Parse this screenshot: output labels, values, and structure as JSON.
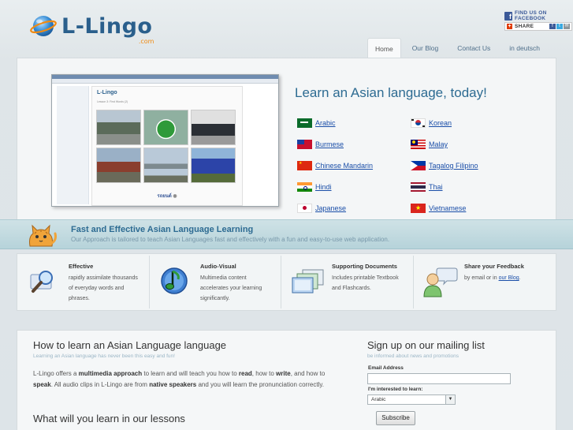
{
  "header": {
    "logo_text": "L-Lingo",
    "logo_sub": ".com",
    "facebook_label": "FIND US ON FACEBOOK",
    "share_label": "SHARE"
  },
  "nav": [
    {
      "label": "Home",
      "active": true
    },
    {
      "label": "Our Blog",
      "active": false
    },
    {
      "label": "Contact Us",
      "active": false
    },
    {
      "label": "in deutsch",
      "active": false
    }
  ],
  "hero": {
    "title": "Learn an Asian language, today!",
    "screenshot": {
      "logo": "L-Lingo",
      "heading": "Lesson 3: First Words (2)",
      "footer_word": "รถยนต์"
    },
    "languages": [
      {
        "name": "Arabic",
        "flag": "arabic-flag"
      },
      {
        "name": "Korean",
        "flag": "korean-flag"
      },
      {
        "name": "Burmese",
        "flag": "burmese-flag"
      },
      {
        "name": "Malay",
        "flag": "malay-flag"
      },
      {
        "name": "Chinese Mandarin",
        "flag": "chinese-flag"
      },
      {
        "name": "Tagalog Filipino",
        "flag": "filipino-flag"
      },
      {
        "name": "Hindi",
        "flag": "hindi-flag"
      },
      {
        "name": "Thai",
        "flag": "thai-flag"
      },
      {
        "name": "Japanese",
        "flag": "japanese-flag"
      },
      {
        "name": "Vietnamese",
        "flag": "vietnamese-flag"
      }
    ]
  },
  "banner": {
    "title": "Fast and Effective Asian Language Learning",
    "subtitle": "Our Approach is tailored to teach Asian Languages fast and effectively with a fun and easy-to-use web application."
  },
  "features": [
    {
      "title": "Effective",
      "text": "rapidly assimilate thousands of everyday words and phrases.",
      "icon": "magnifier-icon"
    },
    {
      "title": "Audio-Visual",
      "text": "Multimedia content accelerates your learning significantly.",
      "icon": "music-note-icon"
    },
    {
      "title": "Supporting Documents",
      "text": "Includes printable Textbook and Flashcards.",
      "icon": "documents-icon"
    },
    {
      "title": "Share your Feedback",
      "text_before": "by email or in ",
      "link": "our Blog",
      "text_after": ".",
      "icon": "feedback-person-icon"
    }
  ],
  "content": {
    "title": "How to learn an Asian Language language",
    "subtitle": "Learning an Asian language has never been this easy and fun!",
    "para": [
      {
        "t": "L-Lingo offers a "
      },
      {
        "t": "multimedia approach",
        "b": true
      },
      {
        "t": " to learn and will teach you how to "
      },
      {
        "t": "read",
        "b": true
      },
      {
        "t": ", how to "
      },
      {
        "t": "write",
        "b": true
      },
      {
        "t": ", and how to "
      },
      {
        "t": "speak",
        "b": true
      },
      {
        "t": ". All audio clips in L-Lingo are from "
      },
      {
        "t": "native speakers",
        "b": true
      },
      {
        "t": " and you will learn the pronunciation correctly."
      }
    ],
    "title2": "What will you learn in our lessons"
  },
  "mailing": {
    "title": "Sign up on our mailing list",
    "subtitle": "be informed about news and promotions",
    "email_label": "Email Address",
    "email_value": "",
    "interest_label": "I'm interested to learn:",
    "interest_value": "Arabic",
    "submit_label": "Subscribe"
  },
  "colors": {
    "brand_blue": "#2a5f8c",
    "brand_orange": "#f08a12",
    "link": "#1a4ea8",
    "facebook": "#3b5998"
  }
}
